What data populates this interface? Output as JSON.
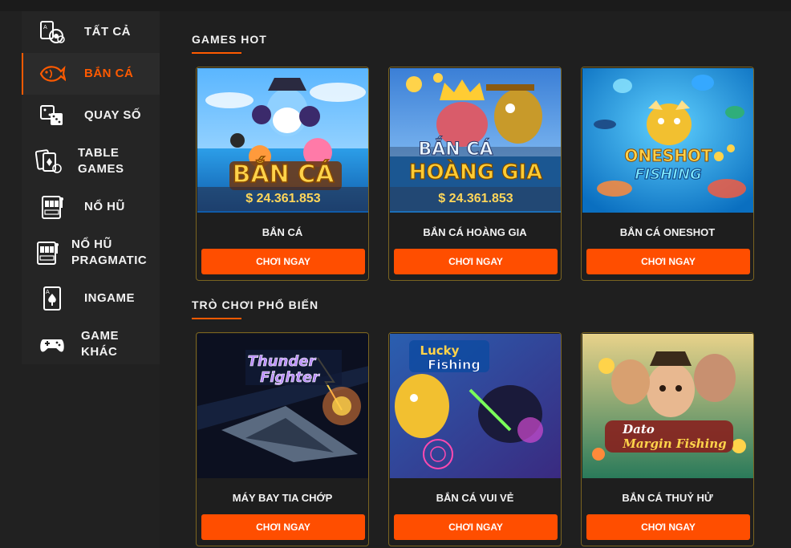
{
  "sidebar": {
    "items": [
      {
        "label": "TẤT CẢ",
        "icon": "casino-chips-icon",
        "active": false
      },
      {
        "label": "BẮN CÁ",
        "icon": "fish-icon",
        "active": true
      },
      {
        "label": "QUAY SỐ",
        "icon": "dice-icon",
        "active": false
      },
      {
        "label": "TABLE GAMES",
        "icon": "playing-cards-icon",
        "active": false
      },
      {
        "label": "NỔ HŨ",
        "icon": "slot-machine-icon",
        "active": false
      },
      {
        "label": "NỔ HŨ PRAGMATIC",
        "icon": "slot-machine-icon",
        "active": false
      },
      {
        "label": "INGAME",
        "icon": "card-spade-icon",
        "active": false
      },
      {
        "label": "GAME KHÁC",
        "icon": "gamepad-icon",
        "active": false
      }
    ]
  },
  "sections": [
    {
      "title": "GAMES HOT",
      "games": [
        {
          "name": "BẮN CÁ",
          "button": "CHƠI NGAY",
          "jackpot": "$ 24.361.853",
          "art_title": "BẮN CÁ"
        },
        {
          "name": "BẮN CÁ HOÀNG GIA",
          "button": "CHƠI NGAY",
          "jackpot": "$ 24.361.853",
          "art_title": "BẮN CÁ",
          "art_title2": "HOÀNG GIA"
        },
        {
          "name": "BẮN CÁ ONESHOT",
          "button": "CHƠI NGAY",
          "art_title": "ONESHOT",
          "art_title2": "FISHING"
        }
      ]
    },
    {
      "title": "TRÒ CHƠI PHỔ BIẾN",
      "games": [
        {
          "name": "MÁY BAY TIA CHỚP",
          "button": "CHƠI NGAY",
          "art_title": "Thunder",
          "art_title2": "Fighter"
        },
        {
          "name": "BẮN CÁ VUI VẺ",
          "button": "CHƠI NGAY",
          "art_title": "Lucky",
          "art_title2": "Fishing"
        },
        {
          "name": "BẮN CÁ THUỶ HỬ",
          "button": "CHƠI NGAY",
          "art_title": "Dato",
          "art_title2": "Margin Fishing"
        }
      ]
    }
  ],
  "colors": {
    "accent": "#ff4e00",
    "card_border": "#7a6420",
    "jackpot": "#ffd65a"
  }
}
